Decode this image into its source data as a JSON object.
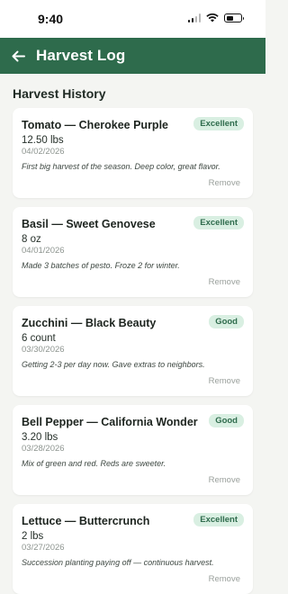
{
  "status_bar": {
    "time": "9:40"
  },
  "app_bar": {
    "title": "Harvest Log",
    "back_icon": "arrow-left-icon"
  },
  "section_title": "Harvest History",
  "entries": [
    {
      "title": "Tomato — Cherokee Purple",
      "amount": "12.50 lbs",
      "date": "04/02/2026",
      "rating": "Excellent",
      "note": "First big harvest of the season. Deep color, great flavor.",
      "remove_label": "Remove"
    },
    {
      "title": "Basil — Sweet Genovese",
      "amount": "8 oz",
      "date": "04/01/2026",
      "rating": "Excellent",
      "note": "Made 3 batches of pesto. Froze 2 for winter.",
      "remove_label": "Remove"
    },
    {
      "title": "Zucchini — Black Beauty",
      "amount": "6 count",
      "date": "03/30/2026",
      "rating": "Good",
      "note": "Getting 2-3 per day now. Gave extras to neighbors.",
      "remove_label": "Remove"
    },
    {
      "title": "Bell Pepper — California Wonder",
      "amount": "3.20 lbs",
      "date": "03/28/2026",
      "rating": "Good",
      "note": "Mix of green and red. Reds are sweeter.",
      "remove_label": "Remove"
    },
    {
      "title": "Lettuce — Buttercrunch",
      "amount": "2 lbs",
      "date": "03/27/2026",
      "rating": "Excellent",
      "note": "Succession planting paying off — continuous harvest.",
      "remove_label": "Remove"
    }
  ],
  "colors": {
    "brand": "#2e6b4c",
    "badge_bg": "#d9efe2",
    "background": "#f4f5f2"
  }
}
